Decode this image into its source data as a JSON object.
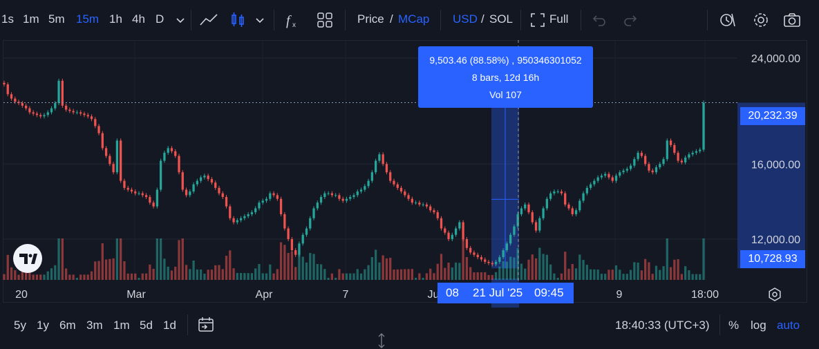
{
  "toolbar": {
    "intervals": [
      "1s",
      "1m",
      "5m",
      "15m",
      "1h",
      "4h",
      "D"
    ],
    "active_interval": "15m",
    "price_label": "Price",
    "slash": "/",
    "mcap_label": "MCap",
    "usd_label": "USD",
    "sol_label": "SOL",
    "full_label": "Full"
  },
  "bottom": {
    "ranges": [
      "5y",
      "1y",
      "6m",
      "3m",
      "1m",
      "5d",
      "1d"
    ],
    "clock": "18:40:33 (UTC+3)",
    "percent": "%",
    "log": "log",
    "auto": "auto"
  },
  "measure": {
    "line1": "9,503.46 (88.58%) , 950346301052",
    "line2": "8 bars, 12d 16h",
    "line3": "Vol 107",
    "top_price": "20,232.39",
    "bottom_price": "10,728.93"
  },
  "crosshair": {
    "date_left": "08",
    "date_mid": "21 Jul '25",
    "time": "09:45"
  },
  "colors": {
    "up": "#26a69a",
    "down": "#ef5350",
    "accent": "#2962ff",
    "bg": "#131722"
  },
  "chart_data": {
    "type": "candlestick",
    "y_ticks": [
      "24,000.00",
      "16,000.00",
      "12,000.00"
    ],
    "x_ticks": [
      "20",
      "Mar",
      "Apr",
      "7",
      "Ju",
      "9",
      "18:00"
    ],
    "last_price": 20232.39,
    "y_scale": "log",
    "grid": true,
    "close": [
      21700,
      20900,
      20550,
      20300,
      20200,
      20000,
      19800,
      19500,
      19400,
      19300,
      19200,
      19300,
      19500,
      19800,
      20200,
      22000,
      20000,
      19700,
      19600,
      19500,
      19500,
      19400,
      19300,
      19200,
      19000,
      18500,
      18000,
      17000,
      16500,
      16000,
      15500,
      17500,
      15000,
      14600,
      14500,
      14400,
      14300,
      14300,
      14200,
      14100,
      13800,
      13600,
      14500,
      16200,
      16700,
      17000,
      16800,
      16500,
      15500,
      14500,
      14200,
      14400,
      14800,
      15000,
      15200,
      15300,
      15100,
      14900,
      14600,
      14300,
      14100,
      13600,
      13000,
      12800,
      12900,
      13000,
      13100,
      13200,
      13300,
      13500,
      13800,
      13900,
      14000,
      14300,
      14200,
      14000,
      13200,
      12500,
      12000,
      11500,
      11300,
      11800,
      12200,
      12500,
      13000,
      13500,
      13800,
      14100,
      14300,
      14300,
      14200,
      14200,
      14000,
      13900,
      14000,
      14100,
      14200,
      14400,
      14500,
      14700,
      15000,
      15500,
      16200,
      16600,
      16000,
      15500,
      15000,
      14800,
      14600,
      14400,
      14200,
      14000,
      13800,
      13800,
      13700,
      13700,
      13600,
      13400,
      13300,
      13000,
      12500,
      12300,
      12000,
      12200,
      12500,
      12800,
      12000,
      11600,
      11400,
      11300,
      11200,
      11100,
      11000,
      10950,
      10900,
      11000,
      11200,
      11500,
      11800,
      12200,
      12600,
      13200,
      13500,
      13700,
      13300,
      12800,
      12400,
      13000,
      13500,
      14000,
      14300,
      14400,
      14400,
      14300,
      13700,
      13500,
      13200,
      13400,
      13900,
      14300,
      14600,
      14800,
      15000,
      15200,
      15300,
      15400,
      15200,
      15000,
      15300,
      15500,
      15600,
      15700,
      15900,
      16300,
      16700,
      16500,
      16000,
      15600,
      15500,
      15800,
      16000,
      16300,
      17500,
      17200,
      16700,
      16200,
      16100,
      16400,
      16600,
      16700,
      16800,
      16900,
      20232
    ]
  }
}
